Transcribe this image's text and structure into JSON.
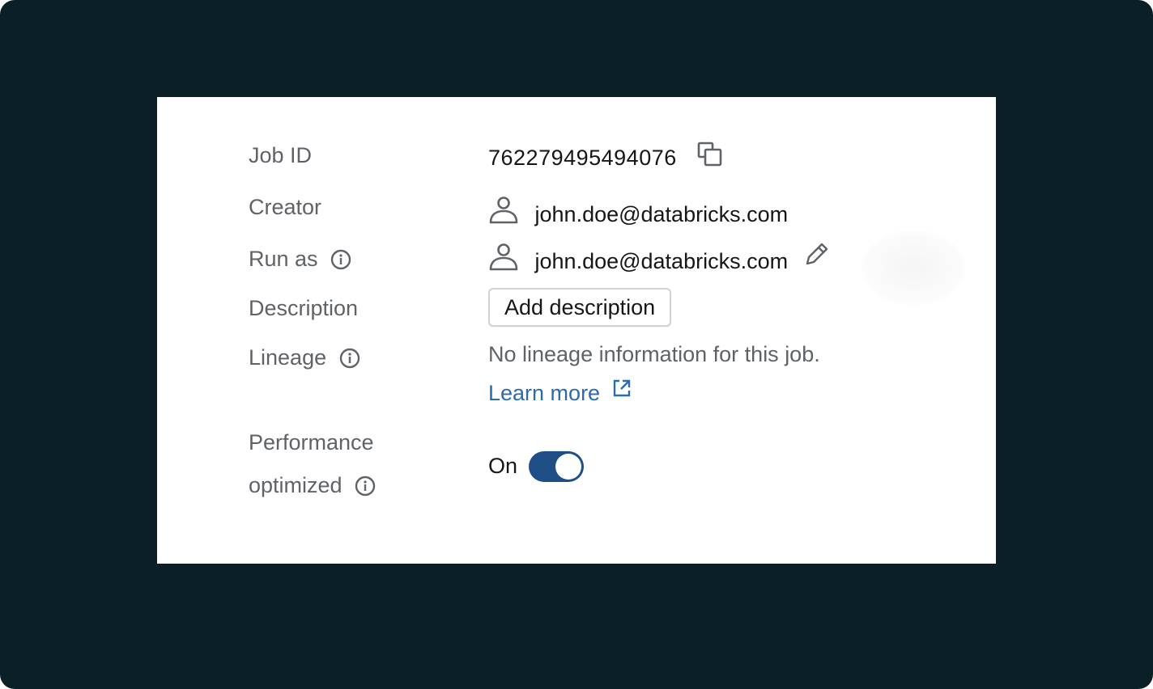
{
  "details": {
    "job_id": {
      "label": "Job ID",
      "value": "762279495494076"
    },
    "creator": {
      "label": "Creator",
      "value": "john.doe@databricks.com"
    },
    "run_as": {
      "label": "Run as",
      "value": "john.doe@databricks.com"
    },
    "description": {
      "label": "Description",
      "button_label": "Add description"
    },
    "lineage": {
      "label": "Lineage",
      "message": "No lineage information for this job.",
      "link_label": "Learn more"
    },
    "performance": {
      "label_line1": "Performance",
      "label_line2": "optimized",
      "toggle_label": "On",
      "enabled": true
    }
  },
  "colors": {
    "frame_background": "#0b1f26",
    "card_background": "#ffffff",
    "label": "#5f6368",
    "value": "#161616",
    "link": "#2a6bb0",
    "toggle_on": "#1f4d86"
  },
  "icons": {
    "copy": "copy-icon",
    "user": "user-icon",
    "info": "info-icon",
    "edit": "pencil-icon",
    "external": "external-link-icon"
  }
}
